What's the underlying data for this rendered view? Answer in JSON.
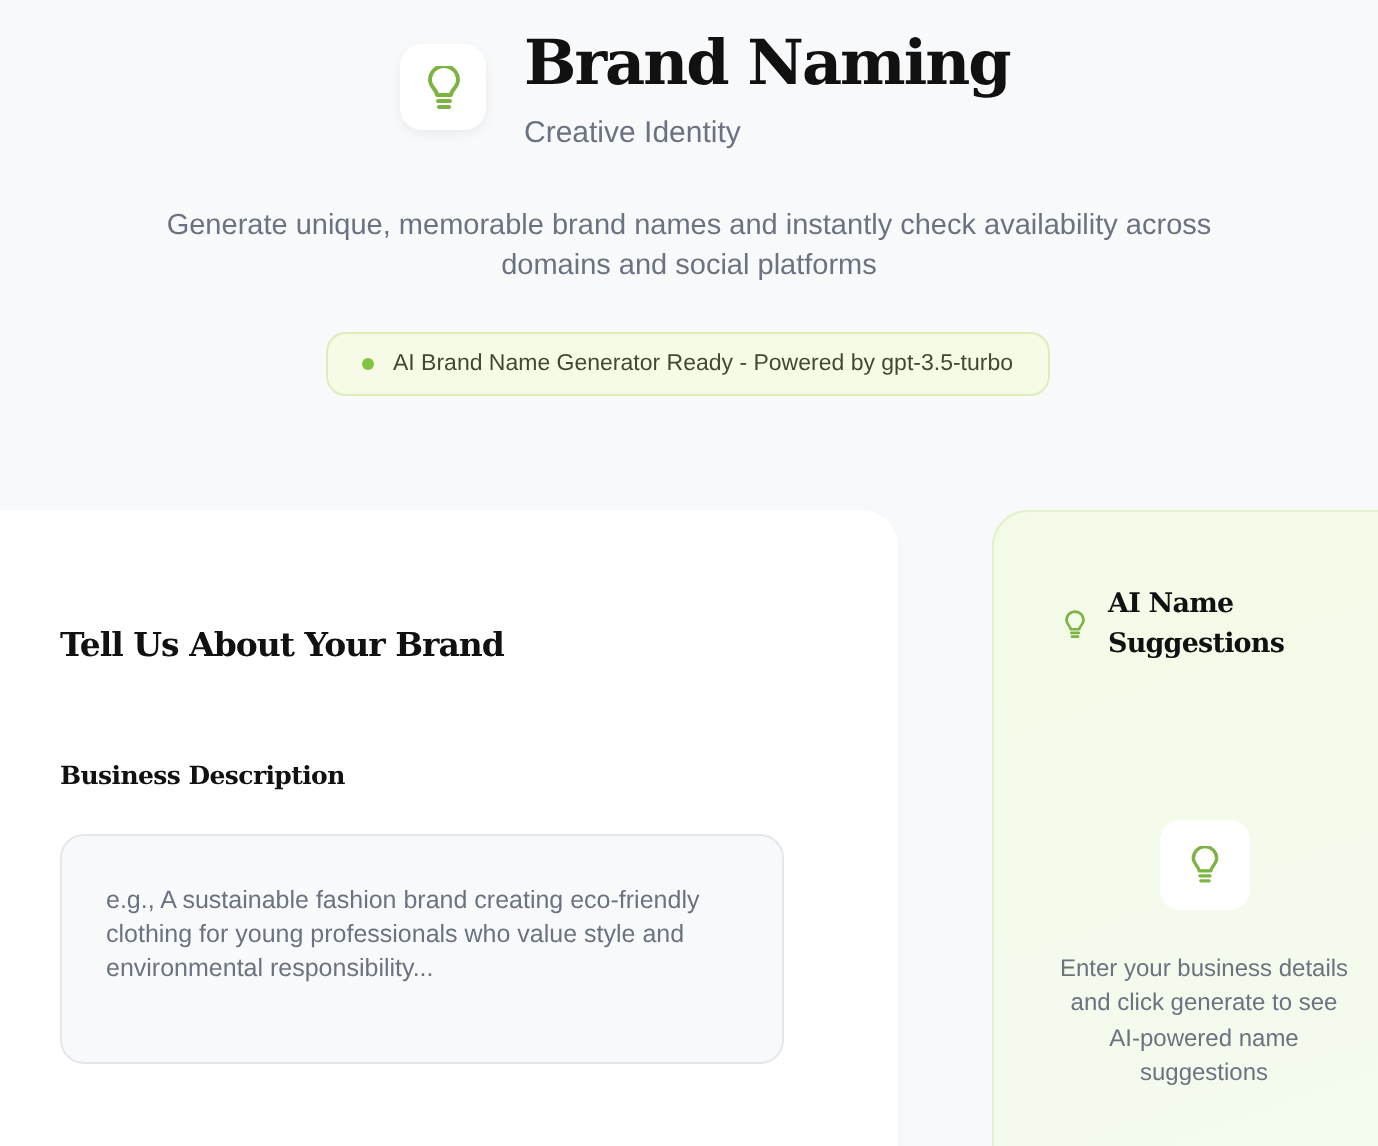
{
  "header": {
    "title": "Brand Naming",
    "subtitle": "Creative Identity"
  },
  "description": "Generate unique, memorable brand names and instantly check availability across domains and social platforms",
  "status_badge": {
    "text": "AI Brand Name Generator Ready - Powered by gpt-3.5-turbo",
    "color": "#84c341"
  },
  "form": {
    "title": "Tell Us About Your Brand",
    "field_label": "Business Description",
    "placeholder": "e.g., A sustainable fashion brand creating eco-friendly clothing for young professionals who value style and environmental responsibility..."
  },
  "suggestions": {
    "title": "AI Name Suggestions",
    "empty_text": "Enter your business details and click generate to see AI-powered name suggestions"
  }
}
